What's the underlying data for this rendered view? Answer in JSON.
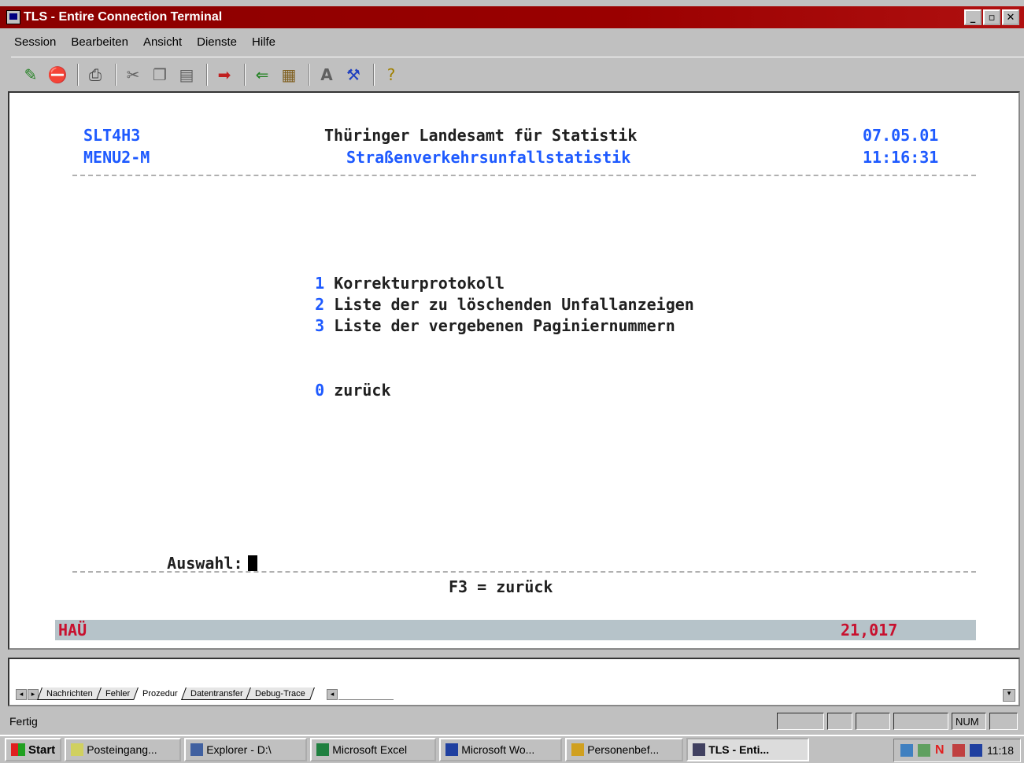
{
  "window": {
    "title": "TLS - Entire Connection Terminal",
    "controls": [
      "_",
      "▫",
      "✕"
    ]
  },
  "menu": [
    "Session",
    "Bearbeiten",
    "Ansicht",
    "Dienste",
    "Hilfe"
  ],
  "toolbar_icons": [
    "properties-icon",
    "disconnect-icon",
    "print-icon",
    "cut-icon",
    "copy-icon",
    "paste-icon",
    "transfer-icon",
    "receive-icon",
    "send-icon",
    "font-icon",
    "tools-icon",
    "help-icon"
  ],
  "terminal": {
    "program": "SLT4H3",
    "menu_id": "MENU2-M",
    "org_title": "Thüringer Landesamt für Statistik",
    "subtitle": "Straßenverkehrsunfallstatistik",
    "date": "07.05.01",
    "time": "11:16:31",
    "options": [
      {
        "key": "1",
        "label": "Korrekturprotokoll"
      },
      {
        "key": "2",
        "label": "Liste der zu löschenden Unfallanzeigen"
      },
      {
        "key": "3",
        "label": "Liste der vergebenen Paginiernummern"
      }
    ],
    "back_option": {
      "key": "0",
      "label": "zurück"
    },
    "prompt_label": "Auswahl:",
    "fkey_hint": "F3 = zurück",
    "status_left": "HAÜ",
    "status_right": "21,017"
  },
  "bottom_tabs": [
    "Nachrichten",
    "Fehler",
    "Prozedur",
    "Datentransfer",
    "Debug-Trace"
  ],
  "active_tab": "Prozedur",
  "statusbar": {
    "text": "Fertig",
    "num": "NUM"
  },
  "taskbar": {
    "start": "Start",
    "tasks": [
      "Posteingang...",
      "Explorer - D:\\",
      "Microsoft Excel",
      "Microsoft Wo...",
      "Personenbef...",
      "TLS - Enti..."
    ],
    "active_task": "TLS - Enti...",
    "clock": "11:18"
  }
}
